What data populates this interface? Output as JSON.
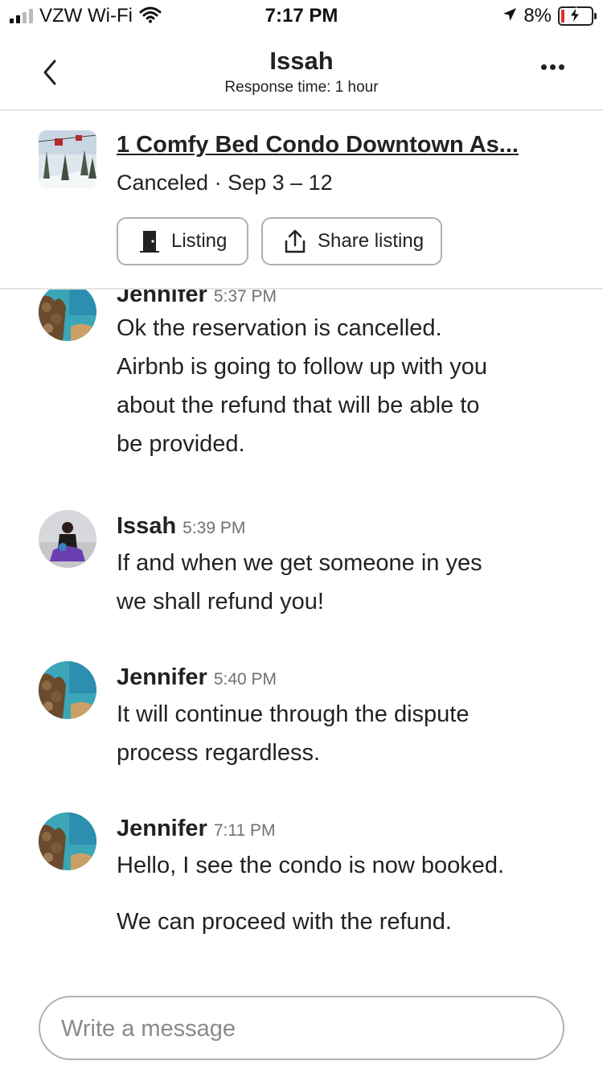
{
  "status_bar": {
    "carrier": "VZW Wi-Fi",
    "time": "7:17 PM",
    "battery_percent": "8%"
  },
  "header": {
    "title": "Issah",
    "subtitle": "Response time: 1 hour"
  },
  "listing": {
    "title": "1 Comfy Bed Condo Downtown As...",
    "status": "Canceled · Sep 3 – 12",
    "listing_button": "Listing",
    "share_button": "Share listing"
  },
  "messages": [
    {
      "sender": "Jennifer",
      "time": "5:37 PM",
      "lines": [
        "Ok the reservation is cancelled.",
        "Airbnb is going to follow up with you",
        "about the refund that will be able to",
        "be provided."
      ]
    },
    {
      "sender": "Issah",
      "time": "5:39 PM",
      "lines": [
        "If and when we get someone in yes",
        "we shall refund you!"
      ]
    },
    {
      "sender": "Jennifer",
      "time": "5:40 PM",
      "lines": [
        "It will continue through the dispute",
        "process regardless."
      ]
    },
    {
      "sender": "Jennifer",
      "time": "7:11 PM",
      "lines": [
        "Hello, I see the condo is now booked.",
        "We can proceed with the refund."
      ]
    }
  ],
  "composer": {
    "placeholder": "Write a message"
  },
  "colors": {
    "text": "#222222",
    "muted": "#717171",
    "border": "#b0b0b0",
    "battery_low": "#e0302a"
  }
}
